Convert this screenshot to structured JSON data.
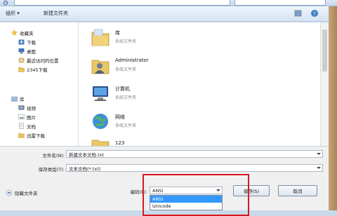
{
  "dialog": {
    "toolbar": {
      "organize": "组织 ▾",
      "new_folder": "新建文件夹"
    },
    "nav": {
      "items": [
        {
          "label": "收藏夹",
          "icon": "star-icon"
        },
        {
          "label": "下载",
          "icon": "download-folder-icon"
        },
        {
          "label": "桌面",
          "icon": "desktop-icon"
        },
        {
          "label": "最近访问的位置",
          "icon": "recent-places-icon"
        },
        {
          "label": "2345下载",
          "icon": "folder-icon"
        },
        {
          "label": "库",
          "icon": "library-icon"
        },
        {
          "label": "视频",
          "icon": "video-icon"
        },
        {
          "label": "图片",
          "icon": "picture-icon"
        },
        {
          "label": "文档",
          "icon": "document-icon"
        },
        {
          "label": "迅雷下载",
          "icon": "folder-icon"
        }
      ]
    },
    "files": [
      {
        "name": "库",
        "type": "系统文件夹",
        "icon": "library-icon"
      },
      {
        "name": "Administrator",
        "type": "系统文件夹",
        "icon": "user-folder-icon"
      },
      {
        "name": "计算机",
        "type": "系统文件夹",
        "icon": "computer-icon"
      },
      {
        "name": "网络",
        "type": "系统文件夹",
        "icon": "network-icon"
      },
      {
        "name": "123",
        "type": "",
        "icon": "folder-icon"
      }
    ],
    "form": {
      "filename_label": "文件名(N):",
      "filename_value": "新建文本文档.txt",
      "filetype_label": "保存类型(T):",
      "filetype_value": "文本文档(*.txt)",
      "encoding_label": "编码(E):",
      "encoding_value": "ANSI",
      "encoding_options": [
        "ANSI",
        "Unicode"
      ],
      "hide_folders": "隐藏文件夹",
      "save": "保存(S)",
      "cancel": "取消"
    },
    "colors": {
      "highlight_border": "#d8181e",
      "selected_option": "#3399ff"
    }
  }
}
